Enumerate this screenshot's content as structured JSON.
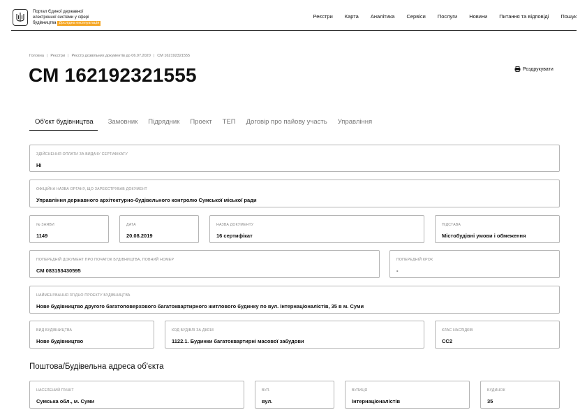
{
  "header": {
    "brand_line1": "Портал Єдиної державної",
    "brand_line2": "електронної системи у сфері",
    "brand_line3": "будівництва",
    "beta_badge": "Дослідна експлуатація",
    "nav": [
      "Реєстри",
      "Карта",
      "Аналітика",
      "Сервіси",
      "Послуги",
      "Новини",
      "Питання та відповіді",
      "Пошук"
    ]
  },
  "breadcrumb": [
    "Головна",
    "Реєстри",
    "Реєстр дозвільних документів до 06.07.2020",
    "CM 162192321555"
  ],
  "page_title": "СМ 162192321555",
  "print_label": "Роздрукувати",
  "tabs": [
    "Об'єкт будівництва",
    "Замовник",
    "Підрядник",
    "Проект",
    "ТЕП",
    "Договір про пайову участь",
    "Управління"
  ],
  "active_tab": 0,
  "fields": {
    "payment": {
      "label": "Здійснення оплати за видачу сертифікату",
      "value": "Ні"
    },
    "authority": {
      "label": "Офіційна назва органу, що зареєстрував документ",
      "value": "Управління державного архітектурно-будівельного контролю Сумської міської ради"
    },
    "application_no": {
      "label": "№ заяви",
      "value": "1149"
    },
    "date": {
      "label": "Дата",
      "value": "20.08.2019"
    },
    "doc_name": {
      "label": "Назва документу",
      "value": "16 сертифікат"
    },
    "basis": {
      "label": "Підстава",
      "value": "Містобудівні умови і обмеження"
    },
    "prev_doc": {
      "label": "Попередній документ про початок будівництва, повний номер",
      "value": "СМ 083153430595"
    },
    "prev_step": {
      "label": "Попередній крок",
      "value": "-"
    },
    "project_name": {
      "label": "Найменування згідно проекту будівництва",
      "value": "Нове будівництво другого багатоповерхового багатоквартирного житлового будинку по вул. Інтернаціоналістів, 35 в м. Суми"
    },
    "construction_type": {
      "label": "Вид будівництва",
      "value": "Нове будівництво"
    },
    "building_code": {
      "label": "Код будівлі за ДК018",
      "value": "1122.1. Будинки багатоквартирні масової забудови"
    },
    "consequence_class": {
      "label": "Клас наслідків",
      "value": "СС2"
    }
  },
  "address_section": {
    "title": "Поштова/Будівельна адреса об'єкта",
    "settlement": {
      "label": "Населений пункт",
      "value": "Сумська обл., м. Суми"
    },
    "street_type": {
      "label": "Вул.",
      "value": "вул."
    },
    "street": {
      "label": "Вулиця",
      "value": "Інтернаціоналістів"
    },
    "building": {
      "label": "Будинок",
      "value": "35"
    }
  }
}
